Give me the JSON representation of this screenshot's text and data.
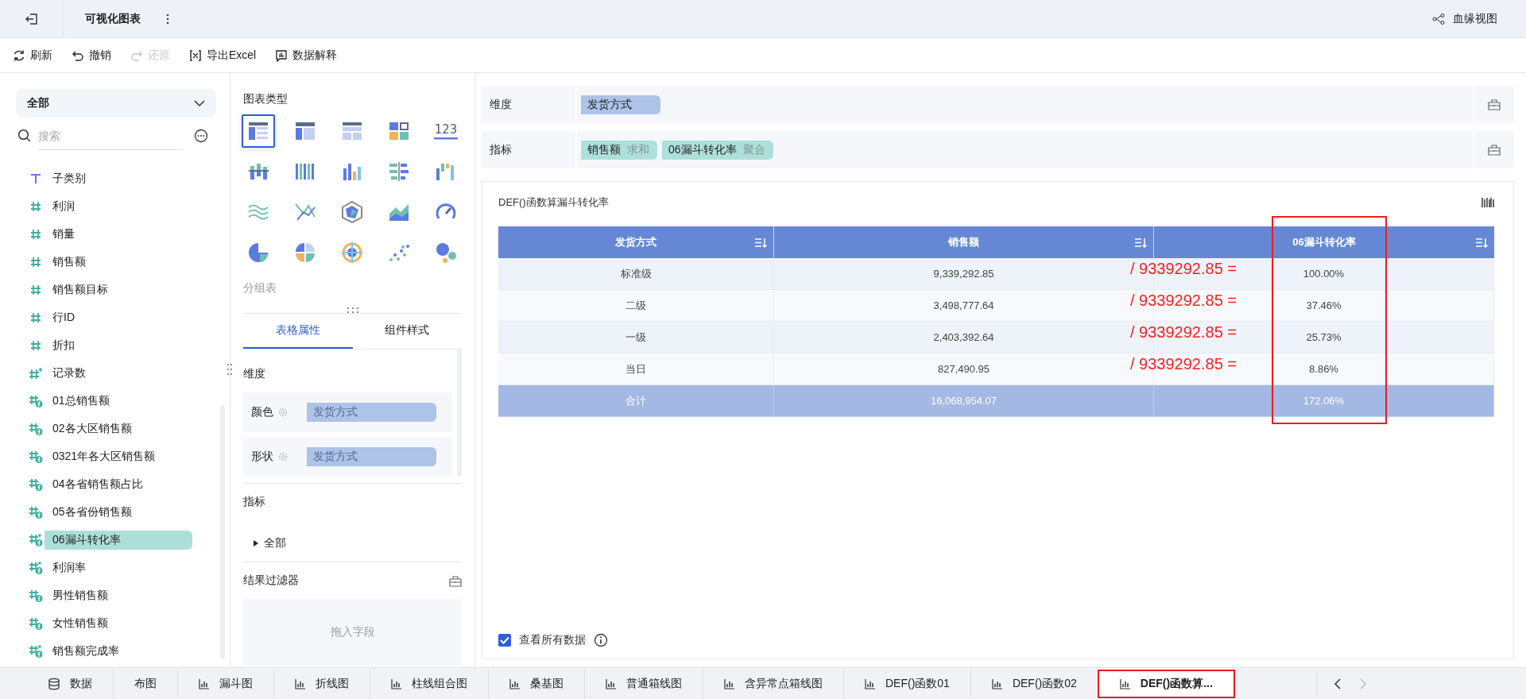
{
  "header": {
    "title": "可视化图表",
    "lineage_label": "血缘视图"
  },
  "toolbar": [
    {
      "label": "刷新",
      "kind": "refresh",
      "disabled": false
    },
    {
      "label": "撤销",
      "kind": "undo",
      "disabled": false
    },
    {
      "label": "还原",
      "kind": "redo",
      "disabled": true
    },
    {
      "label": "导出Excel",
      "kind": "export",
      "disabled": false
    },
    {
      "label": "数据解释",
      "kind": "explain",
      "disabled": false
    }
  ],
  "fields_panel": {
    "dropdown": "全部",
    "search_placeholder": "搜索",
    "fields": [
      {
        "name": "子类别",
        "kind": "text",
        "selected": false
      },
      {
        "name": "利润",
        "kind": "number",
        "selected": false
      },
      {
        "name": "销量",
        "kind": "number",
        "selected": false
      },
      {
        "name": "销售额",
        "kind": "number",
        "selected": false
      },
      {
        "name": "销售额目标",
        "kind": "number",
        "selected": false
      },
      {
        "name": "行ID",
        "kind": "number",
        "selected": false
      },
      {
        "name": "折扣",
        "kind": "number",
        "selected": false
      },
      {
        "name": "记录数",
        "kind": "count",
        "selected": false
      },
      {
        "name": "01总销售额",
        "kind": "calc",
        "selected": false
      },
      {
        "name": "02各大区销售额",
        "kind": "calc",
        "selected": false
      },
      {
        "name": "0321年各大区销售额",
        "kind": "calc",
        "selected": false
      },
      {
        "name": "04各省销售额占比",
        "kind": "calc",
        "selected": false
      },
      {
        "name": "05各省份销售额",
        "kind": "calc",
        "selected": false
      },
      {
        "name": "06漏斗转化率",
        "kind": "calc-agg",
        "selected": true
      },
      {
        "name": "利润率",
        "kind": "calc-agg",
        "selected": false
      },
      {
        "name": "男性销售额",
        "kind": "calc",
        "selected": false
      },
      {
        "name": "女性销售额",
        "kind": "calc",
        "selected": false
      },
      {
        "name": "销售额完成率",
        "kind": "calc-agg",
        "selected": false
      }
    ]
  },
  "chart_types": {
    "title": "图表类型",
    "current": "分组表",
    "items": [
      {
        "selected": true
      },
      {
        "selected": false
      },
      {
        "selected": false
      },
      {
        "selected": false
      },
      {
        "selected": false,
        "label": "123"
      },
      {
        "selected": false
      },
      {
        "selected": false
      },
      {
        "selected": false
      },
      {
        "selected": false
      },
      {
        "selected": false
      },
      {
        "selected": false
      },
      {
        "selected": false
      },
      {
        "selected": false
      },
      {
        "selected": false
      },
      {
        "selected": false
      },
      {
        "selected": false
      },
      {
        "selected": false
      },
      {
        "selected": false
      },
      {
        "selected": false
      },
      {
        "selected": false
      }
    ]
  },
  "property_tabs": [
    {
      "label": "表格属性",
      "selected": true
    },
    {
      "label": "组件样式",
      "selected": false
    }
  ],
  "dimension_section": {
    "title": "维度",
    "rows": [
      {
        "label": "颜色",
        "value": "发货方式"
      },
      {
        "label": "形状",
        "value": "发货方式"
      }
    ]
  },
  "measure_section": {
    "title": "指标",
    "tree": [
      {
        "label": "全部",
        "expanded": false
      }
    ]
  },
  "filter": {
    "title": "结果过滤器",
    "placeholder": "拖入字段"
  },
  "shelves": [
    {
      "label": "维度",
      "chips": [
        {
          "name": "发货方式",
          "kind": "dimension"
        }
      ]
    },
    {
      "label": "指标",
      "chips": [
        {
          "name": "销售额",
          "agg": "求和",
          "kind": "measure"
        },
        {
          "name": "06漏斗转化率",
          "agg": "聚合",
          "kind": "measure"
        }
      ]
    }
  ],
  "widget": {
    "title": "DEF()函数算漏斗转化率",
    "table": {
      "columns": [
        {
          "label": "发货方式",
          "annotated": false
        },
        {
          "label": "销售额",
          "annotated": false
        },
        {
          "label": "06漏斗转化率",
          "annotated": true
        }
      ],
      "rows": [
        {
          "cells": [
            "标准级",
            "9,339,292.85",
            "100.00%"
          ],
          "annotation": "/ 9339292.85 ="
        },
        {
          "cells": [
            "二级",
            "3,498,777.64",
            "37.46%"
          ],
          "annotation": "/ 9339292.85 ="
        },
        {
          "cells": [
            "一级",
            "2,403,392.64",
            "25.73%"
          ],
          "annotation": "/ 9339292.85 ="
        },
        {
          "cells": [
            "当日",
            "827,490.95",
            "8.86%"
          ],
          "annotation": "/ 9339292.85 ="
        }
      ],
      "total": [
        "合计",
        "16,068,954.07",
        "172.06%"
      ]
    },
    "show_all": {
      "label": "查看所有数据",
      "checked": true
    }
  },
  "bottom_tabs": [
    {
      "label": "数据",
      "kind": "data",
      "selected": false,
      "annotated": false
    },
    {
      "label": "布图",
      "kind": "cut",
      "selected": false,
      "annotated": false
    },
    {
      "label": "漏斗图",
      "kind": "chart",
      "selected": false,
      "annotated": false
    },
    {
      "label": "折线图",
      "kind": "chart",
      "selected": false,
      "annotated": false
    },
    {
      "label": "柱线组合图",
      "kind": "chart",
      "selected": false,
      "annotated": false
    },
    {
      "label": "桑基图",
      "kind": "chart",
      "selected": false,
      "annotated": false
    },
    {
      "label": "普通箱线图",
      "kind": "chart",
      "selected": false,
      "annotated": false
    },
    {
      "label": "含异常点箱线图",
      "kind": "chart",
      "selected": false,
      "annotated": false
    },
    {
      "label": "DEF()函数01",
      "kind": "chart",
      "selected": false,
      "annotated": false
    },
    {
      "label": "DEF()函数02",
      "kind": "chart",
      "selected": false,
      "annotated": false
    },
    {
      "label": "DEF()函数算...",
      "kind": "chart",
      "selected": true,
      "annotated": true
    }
  ]
}
